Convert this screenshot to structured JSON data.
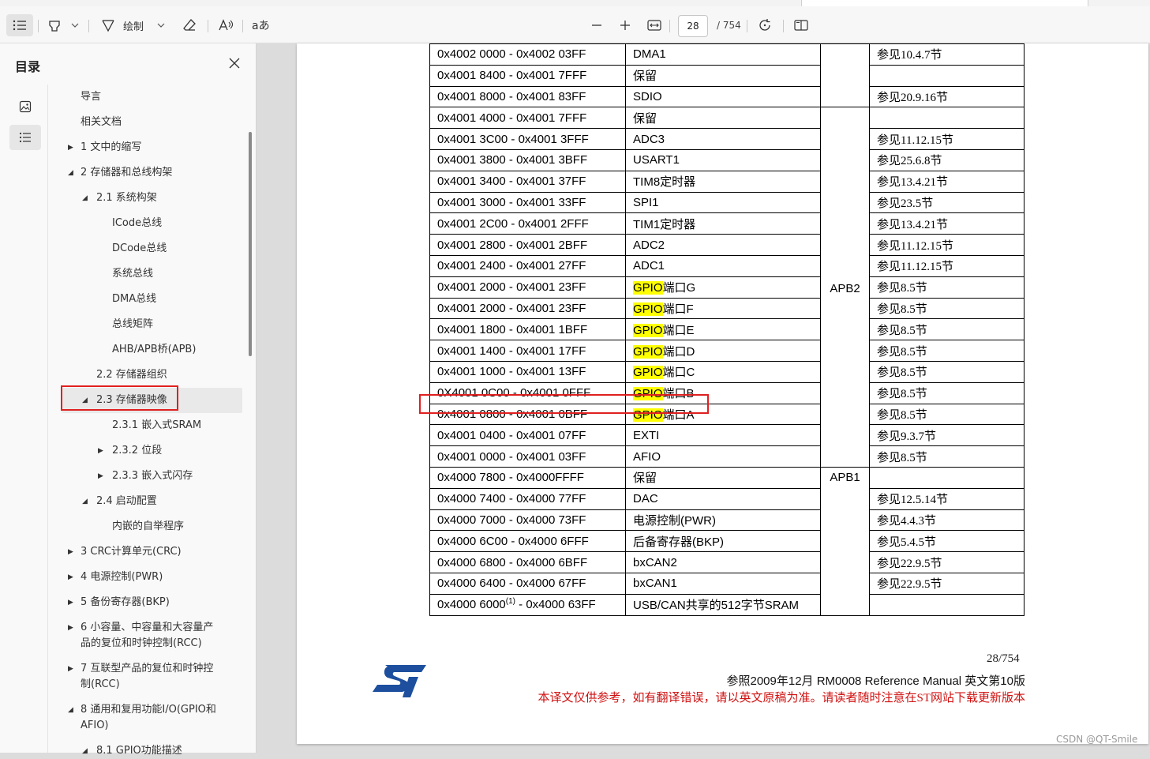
{
  "toolbar": {
    "draw_label": "绘制",
    "current_page": "28",
    "total_pages": "/ 754",
    "icons": [
      "toc-icon",
      "highlight-icon",
      "chevron-down-icon",
      "draw-icon",
      "eraser-icon",
      "read-aloud-icon",
      "translate-icon",
      "zoom-out-icon",
      "zoom-in-icon",
      "fit-width-icon",
      "rotate-icon",
      "page-view-icon"
    ]
  },
  "sidebar": {
    "title": "目录",
    "items": [
      {
        "label": "导言",
        "level": 1,
        "arrow": ""
      },
      {
        "label": "相关文档",
        "level": 1,
        "arrow": ""
      },
      {
        "label": "1 文中的缩写",
        "level": 1,
        "arrow": "collapsed"
      },
      {
        "label": "2 存储器和总线构架",
        "level": 1,
        "arrow": "expanded"
      },
      {
        "label": "2.1 系统构架",
        "level": 2,
        "arrow": "expanded"
      },
      {
        "label": "ICode总线",
        "level": 3,
        "arrow": ""
      },
      {
        "label": "DCode总线",
        "level": 3,
        "arrow": ""
      },
      {
        "label": "系统总线",
        "level": 3,
        "arrow": ""
      },
      {
        "label": "DMA总线",
        "level": 3,
        "arrow": ""
      },
      {
        "label": "总线矩阵",
        "level": 3,
        "arrow": ""
      },
      {
        "label": "AHB/APB桥(APB)",
        "level": 3,
        "arrow": ""
      },
      {
        "label": "2.2 存储器组织",
        "level": 2,
        "arrow": ""
      },
      {
        "label": "2.3 存储器映像",
        "level": 2,
        "arrow": "expanded",
        "selected": true
      },
      {
        "label": "2.3.1 嵌入式SRAM",
        "level": 3,
        "arrow": ""
      },
      {
        "label": "2.3.2 位段",
        "level": 3,
        "arrow": "collapsed"
      },
      {
        "label": "2.3.3 嵌入式闪存",
        "level": 3,
        "arrow": "collapsed"
      },
      {
        "label": "2.4 启动配置",
        "level": 2,
        "arrow": "expanded"
      },
      {
        "label": "内嵌的自举程序",
        "level": 3,
        "arrow": ""
      },
      {
        "label": "3 CRC计算单元(CRC)",
        "level": 1,
        "arrow": "collapsed"
      },
      {
        "label": "4 电源控制(PWR)",
        "level": 1,
        "arrow": "collapsed"
      },
      {
        "label": "5 备份寄存器(BKP)",
        "level": 1,
        "arrow": "collapsed"
      },
      {
        "label": "6 小容量、中容量和大容量产",
        "label2": "品的复位和时钟控制(RCC)",
        "level": 1,
        "arrow": "collapsed"
      },
      {
        "label": "7 互联型产品的复位和时钟控",
        "label2": "制(RCC)",
        "level": 1,
        "arrow": "collapsed"
      },
      {
        "label": "8 通用和复用功能I/O(GPIO和",
        "label2": "AFIO)",
        "level": 1,
        "arrow": "expanded"
      },
      {
        "label": "8.1 GPIO功能描述",
        "level": 2,
        "arrow": "expanded"
      }
    ]
  },
  "table": {
    "rows": [
      {
        "addr": "0x4002 0000 - 0x4002 03FF",
        "periph": "DMA1",
        "ref": "参见10.4.7节"
      },
      {
        "addr": "0x4001 8400 - 0x4001 7FFF",
        "periph": "保留",
        "ref": ""
      },
      {
        "addr": "0x4001 8000 - 0x4001 83FF",
        "periph": "SDIO",
        "ref": "参见20.9.16节"
      },
      {
        "addr": "0x4001 4000 - 0x4001 7FFF",
        "periph": "保留",
        "ref": ""
      },
      {
        "addr": "0x4001 3C00 - 0x4001 3FFF",
        "periph": "ADC3",
        "ref": "参见11.12.15节"
      },
      {
        "addr": "0x4001 3800 - 0x4001 3BFF",
        "periph": "USART1",
        "ref": "参见25.6.8节"
      },
      {
        "addr": "0x4001 3400 - 0x4001 37FF",
        "periph": "TIM8定时器",
        "ref": "参见13.4.21节"
      },
      {
        "addr": "0x4001 3000 - 0x4001 33FF",
        "periph": "SPI1",
        "ref": "参见23.5节"
      },
      {
        "addr": "0x4001 2C00 - 0x4001 2FFF",
        "periph": "TIM1定时器",
        "ref": "参见13.4.21节"
      },
      {
        "addr": "0x4001 2800 - 0x4001 2BFF",
        "periph": "ADC2",
        "ref": "参见11.12.15节"
      },
      {
        "addr": "0x4001 2400 - 0x4001 27FF",
        "periph": "ADC1",
        "ref": "参见11.12.15节"
      },
      {
        "addr": "0x4001 2000 - 0x4001 23FF",
        "periph_hl": "GPIO",
        "periph": "端口G",
        "ref": "参见8.5节"
      },
      {
        "addr": "0x4001 2000 - 0x4001 23FF",
        "periph_hl": "GPIO",
        "periph": "端口F",
        "ref": "参见8.5节"
      },
      {
        "addr": "0x4001 1800 - 0x4001 1BFF",
        "periph_hl": "GPIO",
        "periph": "端口E",
        "ref": "参见8.5节"
      },
      {
        "addr": "0x4001 1400 - 0x4001 17FF",
        "periph_hl": "GPIO",
        "periph": "端口D",
        "ref": "参见8.5节"
      },
      {
        "addr": "0x4001 1000 - 0x4001 13FF",
        "periph_hl": "GPIO",
        "periph": "端口C",
        "ref": "参见8.5节"
      },
      {
        "addr": "0X4001 0C00 - 0x4001 0FFF",
        "periph_hl": "GPIO",
        "periph": "端口B",
        "ref": "参见8.5节",
        "outlined": true
      },
      {
        "addr": "0x4001 0800 - 0x4001 0BFF",
        "periph_hl": "GPIO",
        "periph": "端口A",
        "ref": "参见8.5节"
      },
      {
        "addr": "0x4001 0400 - 0x4001 07FF",
        "periph": "EXTI",
        "ref": "参见9.3.7节"
      },
      {
        "addr": "0x4001 0000 - 0x4001 03FF",
        "periph": "AFIO",
        "ref": "参见8.5节"
      },
      {
        "addr": "0x4000 7800 - 0x4000FFFF",
        "periph": "保留",
        "ref": ""
      },
      {
        "addr": "0x4000 7400 - 0x4000 77FF",
        "periph": "DAC",
        "ref": "参见12.5.14节"
      },
      {
        "addr": "0x4000 7000 - 0x4000 73FF",
        "periph": "电源控制(PWR)",
        "ref": "参见4.4.3节"
      },
      {
        "addr": "0x4000 6C00 - 0x4000 6FFF",
        "periph": "后备寄存器(BKP)",
        "ref": "参见5.4.5节"
      },
      {
        "addr": "0x4000 6800 - 0x4000 6BFF",
        "periph": "bxCAN2",
        "ref": "参见22.9.5节"
      },
      {
        "addr": "0x4000 6400 - 0x4000 67FF",
        "periph": "bxCAN1",
        "ref": "参见22.9.5节"
      },
      {
        "addr": "0x4000 6000",
        "addr_sup": "(1)",
        "addr_tail": " - 0x4000 63FF",
        "periph": "USB/CAN共享的512字节SRAM",
        "ref": ""
      }
    ],
    "bus_apb2": "APB2",
    "bus_apb1": "APB1"
  },
  "footer": {
    "page_number": "28/754",
    "reference": "参照2009年12月 RM0008 Reference Manual  英文第10版",
    "note": "本译文仅供参考，如有翻译错误，请以英文原稿为准。请读者随时注意在ST网站下载更新版本"
  },
  "watermark": "CSDN @QT-Smile"
}
